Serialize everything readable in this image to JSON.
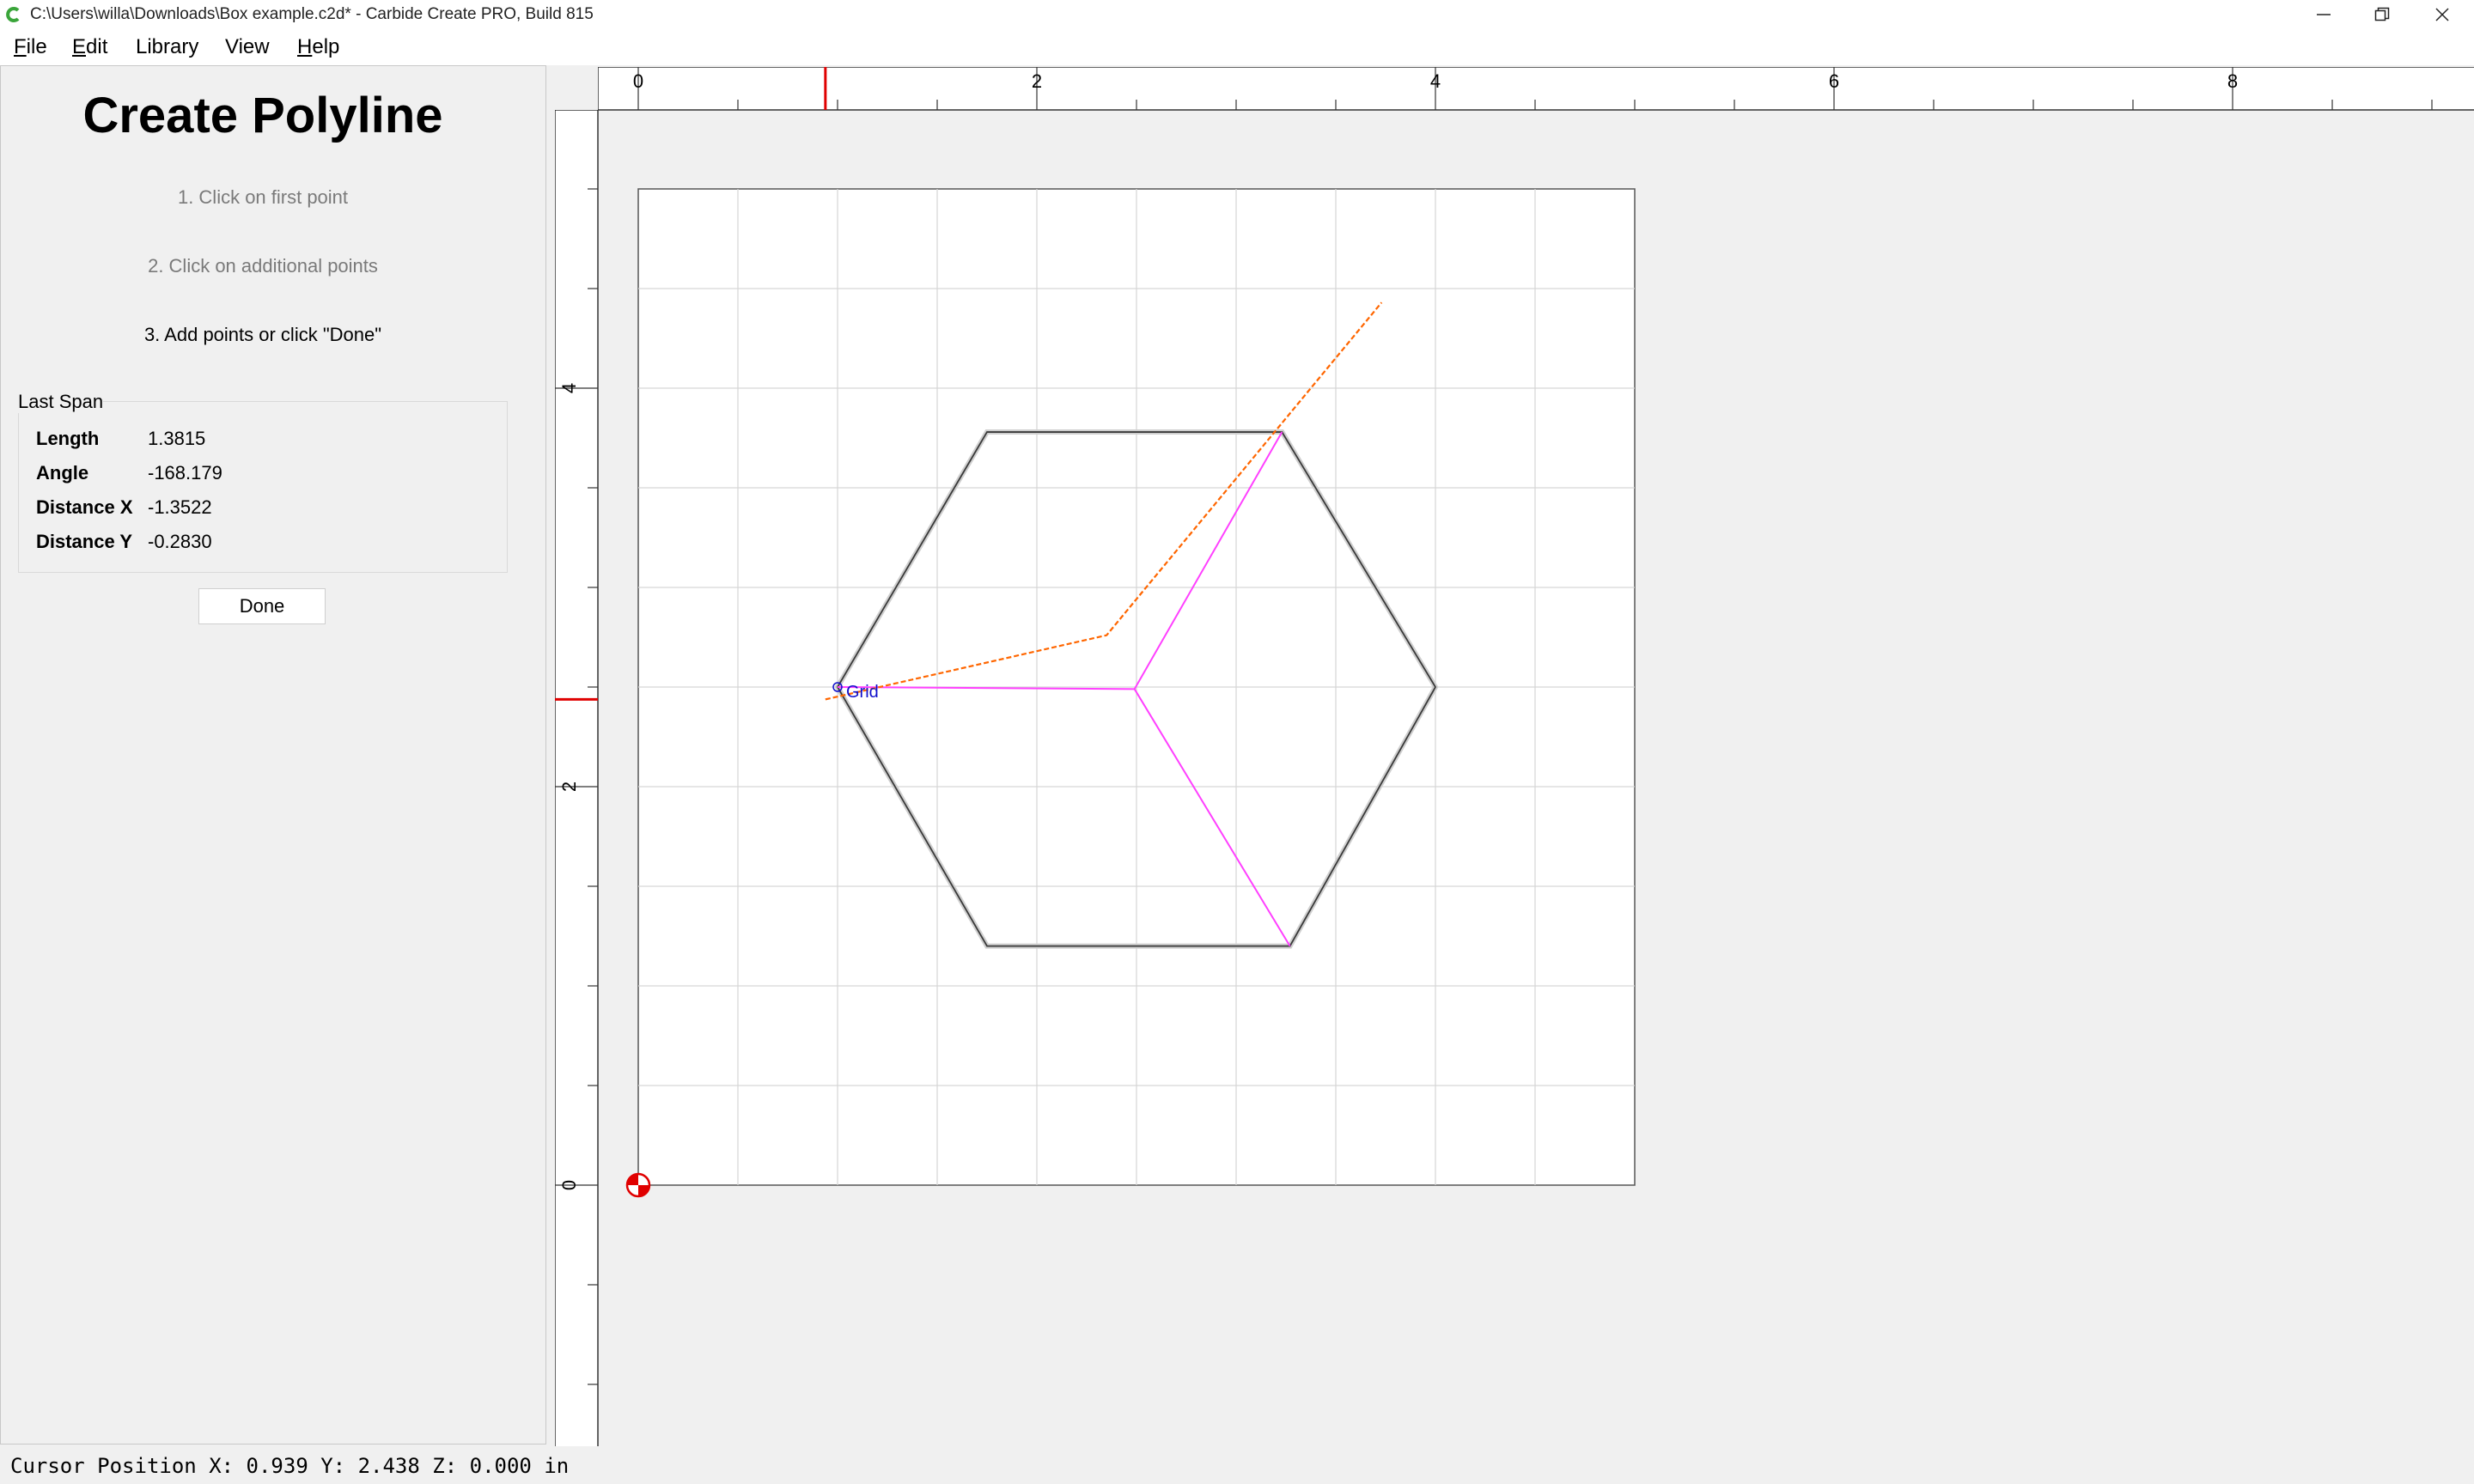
{
  "window": {
    "title": "C:\\Users\\willa\\Downloads\\Box example.c2d* - Carbide Create PRO, Build 815",
    "icon": "carbide-c-icon",
    "controls": [
      "minimize-icon",
      "restore-icon",
      "close-icon"
    ]
  },
  "menu": {
    "items": [
      {
        "accel": "F",
        "rest": "ile"
      },
      {
        "accel": "E",
        "rest": "dit"
      },
      {
        "accel": "",
        "rest": "Library"
      },
      {
        "accel": "",
        "rest": "View"
      },
      {
        "accel": "H",
        "rest": "elp"
      }
    ]
  },
  "panel": {
    "title": "Create Polyline",
    "steps": [
      {
        "text": "1. Click on first point",
        "state": "done"
      },
      {
        "text": "2. Click on additional points",
        "state": "done"
      },
      {
        "text": "3. Add points or click \"Done\"",
        "state": "active"
      }
    ],
    "last_span": {
      "title": "Last Span",
      "rows": [
        {
          "key": "Length",
          "value": "1.3815"
        },
        {
          "key": "Angle",
          "value": "-168.179"
        },
        {
          "key": "Distance X",
          "value": "-1.3522"
        },
        {
          "key": "Distance Y",
          "value": "-0.2830"
        }
      ]
    },
    "done_label": "Done"
  },
  "canvas": {
    "units": "in",
    "h_ruler_labels": [
      "0",
      "2",
      "4",
      "6",
      "8"
    ],
    "v_ruler_labels": [
      "0",
      "2",
      "4"
    ],
    "ruler_marker_x": 0.939,
    "ruler_marker_y": 2.438,
    "stock": {
      "width": 5.0,
      "height": 5.0
    },
    "snap_label": "Grid",
    "colors": {
      "grid": "#d6d6d6",
      "hexagon": "#3a3a3a",
      "magenta": "#ff40ff",
      "preview": "#ff6600",
      "snap": "#1010cc",
      "marker": "#e00000"
    },
    "hexagon": [
      [
        1.75,
        3.78
      ],
      [
        3.23,
        3.78
      ],
      [
        4.0,
        2.5
      ],
      [
        3.27,
        1.2
      ],
      [
        1.75,
        1.2
      ],
      [
        1.0,
        2.5
      ]
    ],
    "magenta_polyline": [
      [
        1.0,
        2.5
      ],
      [
        2.49,
        2.49
      ],
      [
        3.23,
        3.78
      ],
      [
        2.49,
        2.49
      ],
      [
        3.27,
        1.2
      ]
    ],
    "preview_polyline": [
      [
        0.939,
        2.438
      ],
      [
        2.35,
        2.76
      ],
      [
        3.73,
        4.43
      ]
    ]
  },
  "status": {
    "text": "Cursor Position X: 0.939 Y: 2.438 Z: 0.000 in"
  }
}
